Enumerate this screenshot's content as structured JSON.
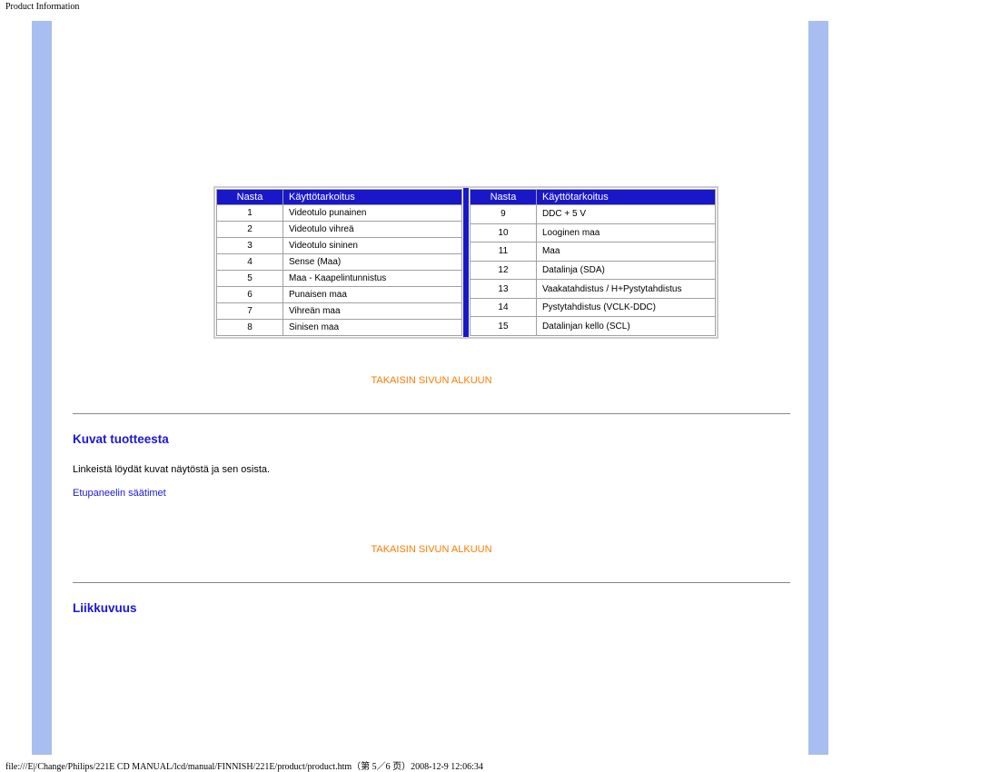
{
  "header_title": "Product Information",
  "pin_tables": {
    "header_pin": "Nasta",
    "header_purpose": "Käyttötarkoitus",
    "left": [
      {
        "n": "1",
        "p": "Videotulo punainen"
      },
      {
        "n": "2",
        "p": "Videotulo vihreä"
      },
      {
        "n": "3",
        "p": "Videotulo sininen"
      },
      {
        "n": "4",
        "p": "Sense (Maa)"
      },
      {
        "n": "5",
        "p": "Maa - Kaapelintunnistus"
      },
      {
        "n": "6",
        "p": "Punaisen maa"
      },
      {
        "n": "7",
        "p": "Vihreän maa"
      },
      {
        "n": "8",
        "p": "Sinisen maa"
      }
    ],
    "right": [
      {
        "n": "9",
        "p": "DDC + 5 V"
      },
      {
        "n": "10",
        "p": "Looginen maa"
      },
      {
        "n": "11",
        "p": "Maa"
      },
      {
        "n": "12",
        "p": "Datalinja (SDA)"
      },
      {
        "n": "13",
        "p": "Vaakatahdistus / H+Pystytahdistus"
      },
      {
        "n": "14",
        "p": "Pystytahdistus (VCLK-DDC)"
      },
      {
        "n": "15",
        "p": "Datalinjan kello (SCL)"
      }
    ]
  },
  "links": {
    "back_to_top": "TAKAISIN SIVUN ALKUUN",
    "front_panel": "Etupaneelin säätimet"
  },
  "sections": {
    "product_images_title": "Kuvat tuotteesta",
    "product_images_text": "Linkeistä löydät kuvat näytöstä ja sen osista.",
    "mobility_title": "Liikkuvuus"
  },
  "footer_path": "file:///E|/Change/Philips/221E CD MANUAL/lcd/manual/FINNISH/221E/product/product.htm（第 5／6 页）2008-12-9 12:06:34"
}
